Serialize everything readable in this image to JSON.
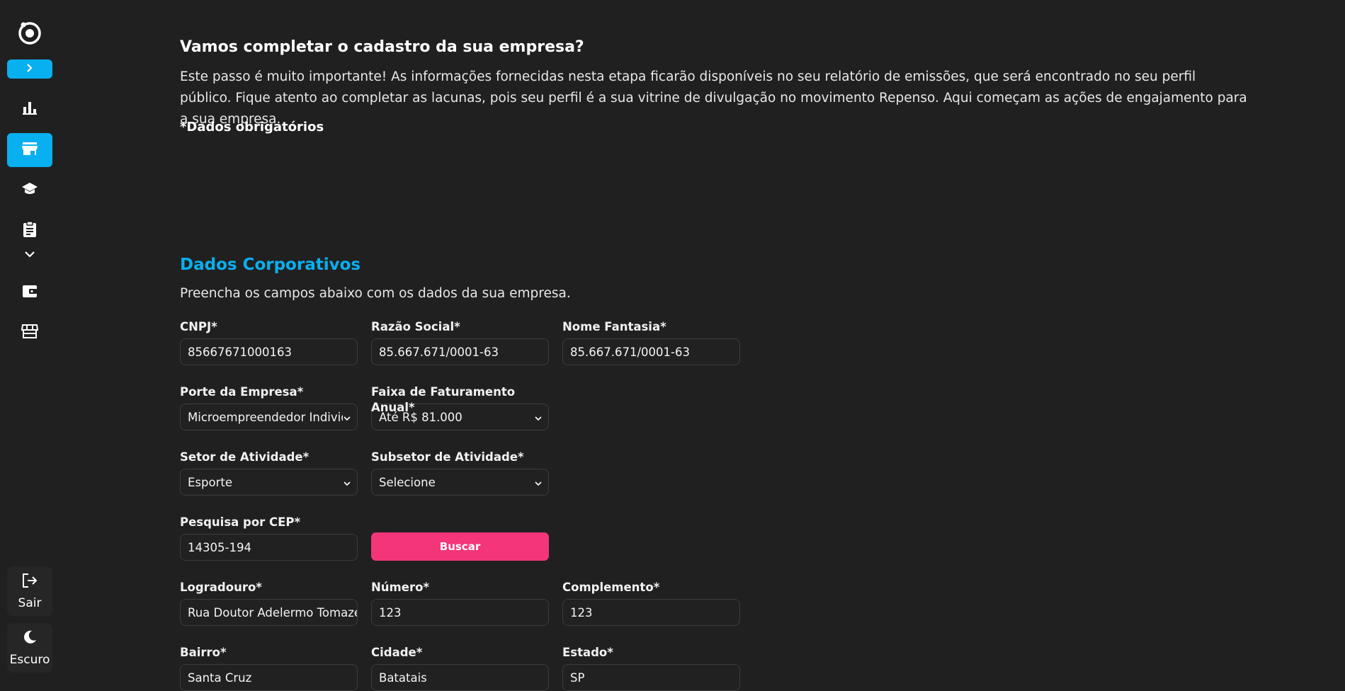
{
  "sidebar": {
    "logo_icon": "repenso-logo",
    "expand_icon": "chevron-right-icon",
    "items": [
      {
        "icon": "bar-chart-icon",
        "active": false
      },
      {
        "icon": "storefront-icon",
        "active": true
      },
      {
        "icon": "graduation-cap-icon",
        "active": false
      },
      {
        "icon": "clipboard-icon",
        "active": false
      },
      {
        "icon": "wallet-icon",
        "active": false
      },
      {
        "icon": "shop-icon",
        "active": false
      }
    ],
    "logout_label": "Sair",
    "theme_label": "Escuro",
    "accent_color": "#09b0f0"
  },
  "intro": {
    "title": "Vamos completar o cadastro da sua empresa?",
    "text": "Este passo é muito importante! As informações fornecidas nesta etapa ficarão disponíveis no seu relatório de emissões, que será encontrado no seu perfil público. Fique atento ao completar as lacunas, pois seu perfil é a sua vitrine de divulgação no movimento Repenso. Aqui começam as ações de engajamento para a sua empresa.",
    "required_note": "*Dados obrigatórios"
  },
  "section": {
    "title": "Dados Corporativos",
    "description": "Preencha os campos abaixo com os dados da sua empresa."
  },
  "form": {
    "cnpj": {
      "label": "CNPJ*",
      "value": "85667671000163"
    },
    "razao_social": {
      "label": "Razão Social*",
      "value": "85.667.671/0001-63"
    },
    "nome_fantasia": {
      "label": "Nome Fantasia*",
      "value": "85.667.671/0001-63"
    },
    "porte": {
      "label": "Porte da Empresa*",
      "value": "Microempreendedor Individual"
    },
    "faturamento": {
      "label": "Faixa de Faturamento Anual*",
      "value": "Até R$ 81.000"
    },
    "setor": {
      "label": "Setor de Atividade*",
      "value": "Esporte"
    },
    "subsetor": {
      "label": "Subsetor de Atividade*",
      "value": "Selecione"
    },
    "cep": {
      "label": "Pesquisa por CEP*",
      "value": "14305-194"
    },
    "buscar_label": "Buscar",
    "logradouro": {
      "label": "Logradouro*",
      "value": "Rua Doutor Adelermo Tomazella"
    },
    "numero": {
      "label": "Número*",
      "value": "123"
    },
    "complemento": {
      "label": "Complemento*",
      "value": "123"
    },
    "bairro": {
      "label": "Bairro*",
      "value": "Santa Cruz"
    },
    "cidade": {
      "label": "Cidade*",
      "value": "Batatais"
    },
    "estado": {
      "label": "Estado*",
      "value": "SP"
    }
  },
  "colors": {
    "background": "#202020",
    "accent": "#09b0f0",
    "button": "#f4357a"
  }
}
